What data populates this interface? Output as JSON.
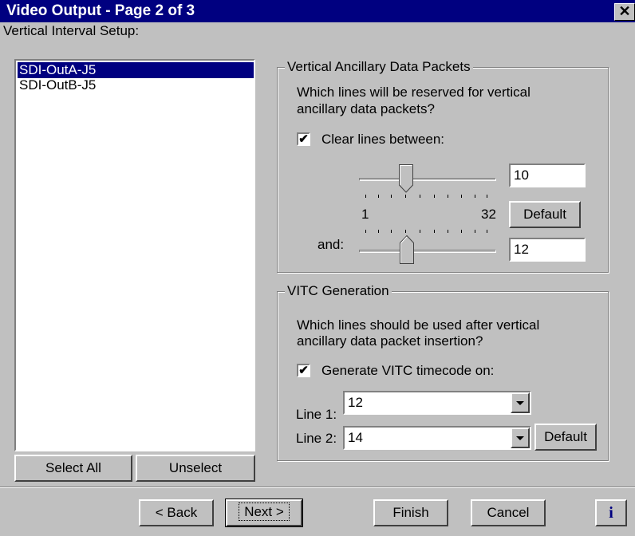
{
  "window": {
    "title": "Video Output - Page 2 of 3",
    "close": "✕"
  },
  "left": {
    "label": "Vertical Interval Setup:",
    "items": [
      "SDI-OutA-J5",
      "SDI-OutB-J5"
    ],
    "selected_index": 0,
    "select_all": "Select All",
    "unselect": "Unselect"
  },
  "vadp": {
    "legend": "Vertical Ancillary Data Packets",
    "question_line1": "Which lines will be reserved for vertical",
    "question_line2": "ancillary data packets?",
    "clear_label": "Clear lines between:",
    "clear_checked": "✔",
    "value1": "10",
    "value2": "12",
    "range_min": "1",
    "range_max": "32",
    "and_label": "and:",
    "default": "Default"
  },
  "vitc": {
    "legend": "VITC Generation",
    "question_line1": "Which lines should be used after vertical",
    "question_line2": "ancillary data packet insertion?",
    "generate_label": "Generate VITC timecode on:",
    "generate_checked": "✔",
    "line1_label": "Line 1:",
    "line1_value": "12",
    "line2_label": "Line 2:",
    "line2_value": "14",
    "default": "Default"
  },
  "nav": {
    "back": "< Back",
    "next": "Next >",
    "finish": "Finish",
    "cancel": "Cancel",
    "info": "i"
  }
}
